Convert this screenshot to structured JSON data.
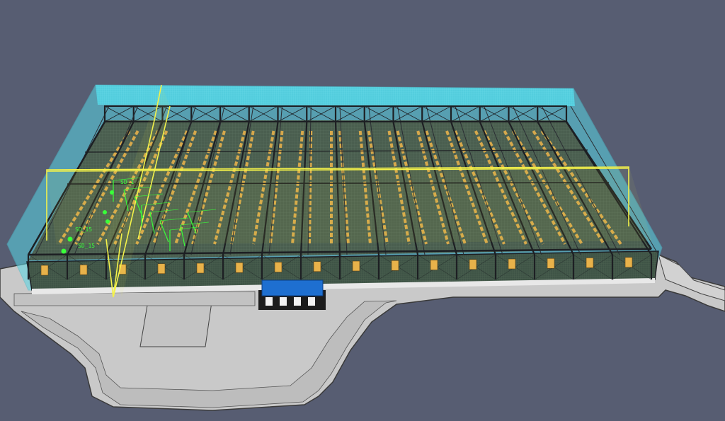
{
  "viewport": {
    "background": "#575d72",
    "colors": {
      "ground": "#c9c9c9",
      "ground_edge": "#3a3a3a",
      "roof_mesh": "#57d6e6",
      "building_interior": "#4b5e50",
      "steel_frame": "#1d1f23",
      "racking": "#d6a84c",
      "section_plane": "#f4f24a",
      "annotation": "#39ff3a",
      "dock_roof": "#1e6fd0"
    }
  },
  "annotations": {
    "labels": [
      "SD_15",
      "SD_15",
      "SD_1"
    ]
  }
}
